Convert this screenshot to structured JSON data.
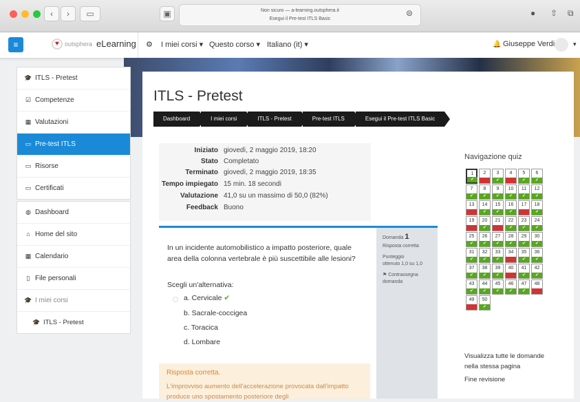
{
  "browser": {
    "url_line1": "Non sicuro — a-learning.outsphera.it",
    "url_line2": "Esegui il Pre-test ITLS Basic",
    "back": "‹",
    "forward": "›"
  },
  "navbar": {
    "brand_small": "outsphera",
    "brand": "eLearning",
    "menu": [
      "I miei corsi ▾",
      "Questo corso ▾",
      "Italiano (it) ▾"
    ],
    "user": "Giuseppe Verdi"
  },
  "sidebar": {
    "group1": [
      {
        "label": "ITLS - Pretest",
        "icon": "🎓"
      },
      {
        "label": "Competenze",
        "icon": "☑"
      },
      {
        "label": "Valutazioni",
        "icon": "▦"
      },
      {
        "label": "Pre-test ITLS",
        "icon": "▭",
        "active": true
      },
      {
        "label": "Risorse",
        "icon": "▭"
      },
      {
        "label": "Certificati",
        "icon": "▭"
      }
    ],
    "group2": [
      {
        "label": "Dashboard",
        "icon": "◍"
      },
      {
        "label": "Home del sito",
        "icon": "⌂"
      },
      {
        "label": "Calendario",
        "icon": "▦"
      },
      {
        "label": "File personali",
        "icon": "▯"
      },
      {
        "label": "I miei corsi",
        "icon": "🎓"
      },
      {
        "label": "ITLS - Pretest",
        "icon": "🎓"
      }
    ]
  },
  "header": {
    "title": "ITLS - Pretest",
    "breadcrumb": [
      "Dashboard",
      "I miei corsi",
      "ITLS - Pretest",
      "Pre-test ITLS",
      "Esegui il Pre-test ITLS Basic"
    ]
  },
  "summary": [
    {
      "label": "Iniziato",
      "value": "giovedì, 2 maggio 2019, 18:20"
    },
    {
      "label": "Stato",
      "value": "Completato"
    },
    {
      "label": "Terminato",
      "value": "giovedì, 2 maggio 2019, 18:35"
    },
    {
      "label": "Tempo impiegato",
      "value": "15 min. 18 secondi"
    },
    {
      "label": "Valutazione",
      "value": "41,0 su un massimo di 50,0 (82%)"
    },
    {
      "label": "Feedback",
      "value": "Buono"
    }
  ],
  "question": {
    "info_label": "Domanda",
    "number": "1",
    "state": "Risposta corretta",
    "score_line1": "Punteggio",
    "score_line2": "ottenuto 1,0 su 1,0",
    "flag_line1": "Contrassegna",
    "flag_line2": "domanda",
    "text": "In un incidente automobilistico a impatto posteriore, quale area della colonna vertebrale è più suscettibile alle lesioni?",
    "prompt": "Scegli un'alternativa:",
    "options": [
      "a. Cervicale",
      "b. Sacrale-coccigea",
      "c. Toracica",
      "d. Lombare"
    ],
    "correct_mark": "✔",
    "feedback_title": "Risposta corretta.",
    "feedback_text": "L'improvviso aumento dell'accelerazione provocata dall'impatto produce uno spostamento posteriore degli"
  },
  "quiz_nav": {
    "title": "Navigazione quiz",
    "ok_mark": "✔",
    "ko_mark": "",
    "results": [
      "ok",
      "ko",
      "ok",
      "ko",
      "ok",
      "ok",
      "ok",
      "ok",
      "ok",
      "ok",
      "ok",
      "ok",
      "ko",
      "ok",
      "ok",
      "ok",
      "ko",
      "ok",
      "ko",
      "ok",
      "ko",
      "ok",
      "ok",
      "ok",
      "ok",
      "ok",
      "ok",
      "ok",
      "ok",
      "ok",
      "ok",
      "ok",
      "ok",
      "ko",
      "ok",
      "ok",
      "ok",
      "ok",
      "ok",
      "ko",
      "ok",
      "ok",
      "ok",
      "ok",
      "ok",
      "ok",
      "ok",
      "ko",
      "ko",
      "ok"
    ],
    "link_all": "Visualizza tutte le domande nella stessa pagina",
    "link_end": "Fine revisione"
  }
}
